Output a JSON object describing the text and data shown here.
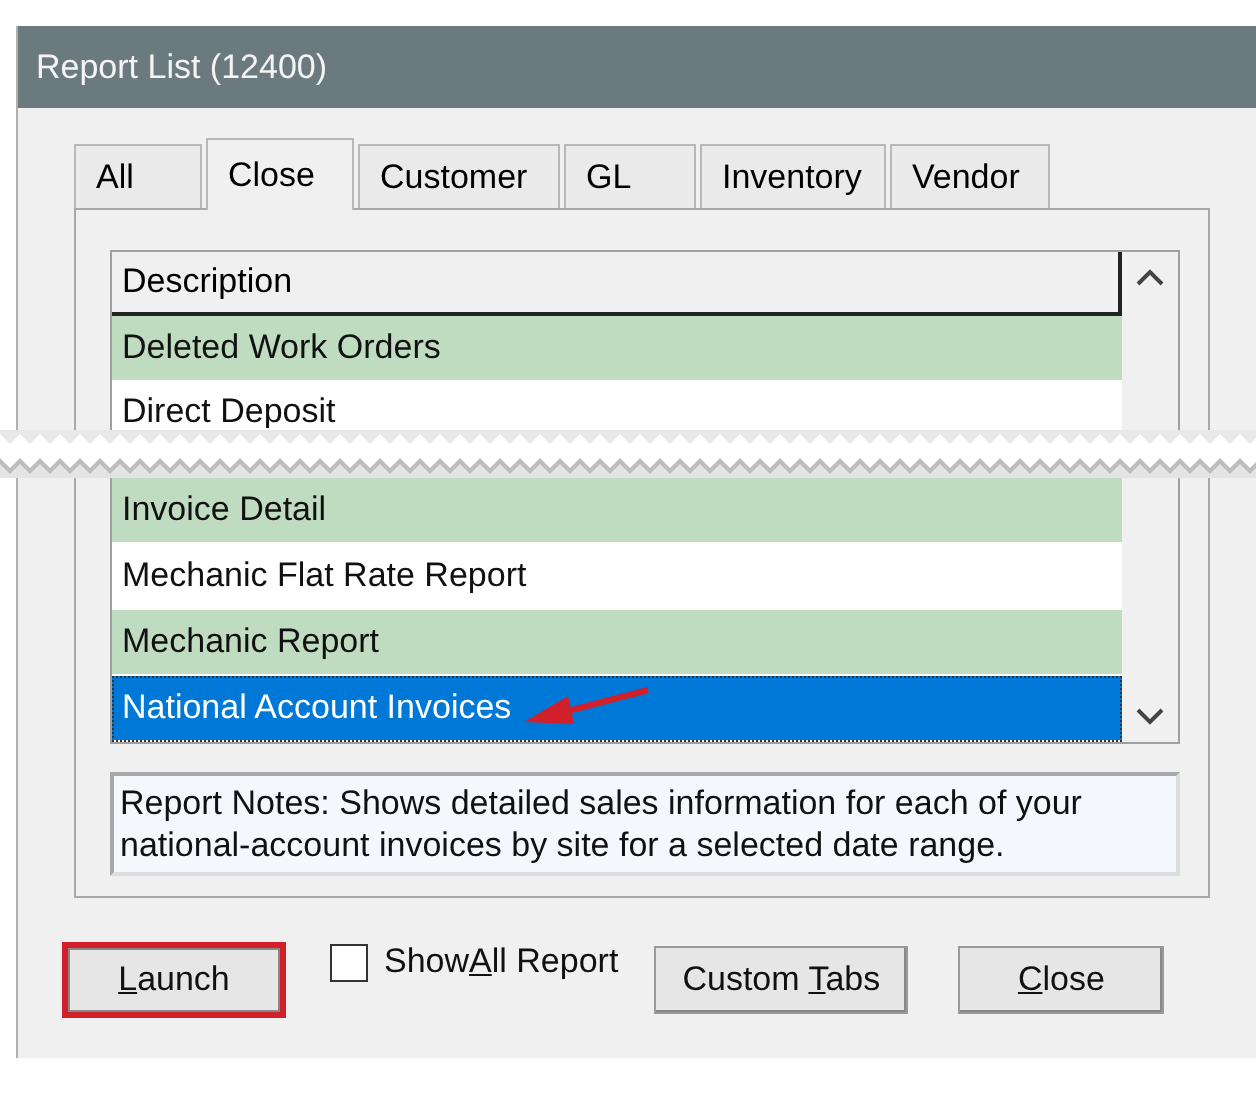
{
  "window": {
    "title": "Report List (12400)"
  },
  "tabs": [
    {
      "label": "All",
      "selected": false
    },
    {
      "label": "Close",
      "selected": true
    },
    {
      "label": "Customer",
      "selected": false
    },
    {
      "label": "GL",
      "selected": false
    },
    {
      "label": "Inventory",
      "selected": false
    },
    {
      "label": "Vendor",
      "selected": false
    }
  ],
  "list": {
    "header": "Description",
    "rows": [
      {
        "label": "Deleted Work Orders",
        "shaded": true,
        "selected": false,
        "callout": false,
        "cut_off": false
      },
      {
        "label": "Direct Deposit",
        "shaded": false,
        "selected": false,
        "callout": false,
        "cut_off": true
      },
      {
        "label": "Invoice Detail",
        "shaded": true,
        "selected": false,
        "callout": false,
        "cut_off": false
      },
      {
        "label": "Mechanic Flat Rate Report",
        "shaded": false,
        "selected": false,
        "callout": false,
        "cut_off": false
      },
      {
        "label": "Mechanic Report",
        "shaded": true,
        "selected": false,
        "callout": false,
        "cut_off": false
      },
      {
        "label": "National Account Invoices",
        "shaded": false,
        "selected": true,
        "callout": true,
        "cut_off": false
      }
    ]
  },
  "notes": "Report Notes:  Shows detailed sales information for each of your national-account invoices by site for a selected date range.",
  "launch_button": {
    "key": "L",
    "after": "aunch",
    "callout": true
  },
  "show_all": {
    "before": "Show",
    "key": "A",
    "after": "ll Report",
    "checked": false
  },
  "buttons": [
    {
      "before": "Custom ",
      "key": "T",
      "after": "abs",
      "callout": false
    },
    {
      "key": "C",
      "after": "lose",
      "callout": false
    }
  ]
}
